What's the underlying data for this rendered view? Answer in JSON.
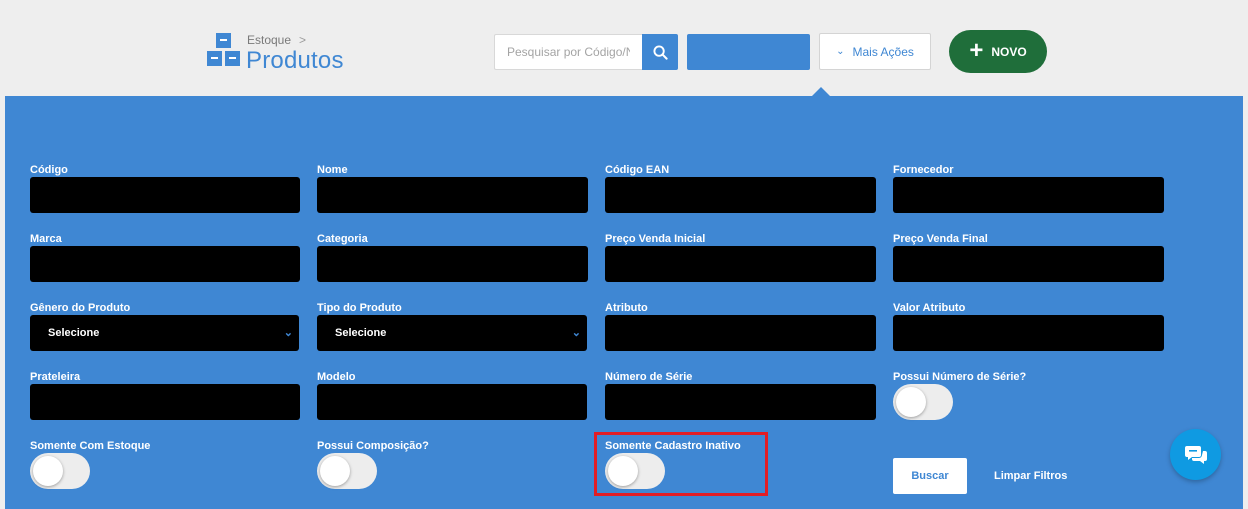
{
  "header": {
    "breadcrumb": "Estoque",
    "breadcrumb_sep": ">",
    "title": "Produtos",
    "search_placeholder": "Pesquisar por Código/Nome",
    "more_actions": "Mais Ações",
    "new_label": "NOVO"
  },
  "filters": {
    "codigo": "Código",
    "nome": "Nome",
    "codigo_ean": "Código EAN",
    "fornecedor": "Fornecedor",
    "marca": "Marca",
    "categoria": "Categoria",
    "preco_inicial": "Preço Venda Inicial",
    "preco_final": "Preço Venda Final",
    "genero": "Gênero do Produto",
    "genero_value": "Selecione",
    "tipo": "Tipo do Produto",
    "tipo_value": "Selecione",
    "atributo": "Atributo",
    "valor_atributo": "Valor Atributo",
    "prateleira": "Prateleira",
    "modelo": "Modelo",
    "numero_serie": "Número de Série",
    "possui_numero_serie": "Possui Número de Série?",
    "somente_estoque": "Somente Com Estoque",
    "possui_composicao": "Possui Composição?",
    "somente_inativo": "Somente Cadastro Inativo"
  },
  "actions": {
    "buscar": "Buscar",
    "limpar": "Limpar Filtros"
  },
  "colors": {
    "primary": "#3f87d3",
    "novo": "#1f6e3a",
    "highlight": "#e21d25",
    "chat": "#0f9ae2"
  }
}
